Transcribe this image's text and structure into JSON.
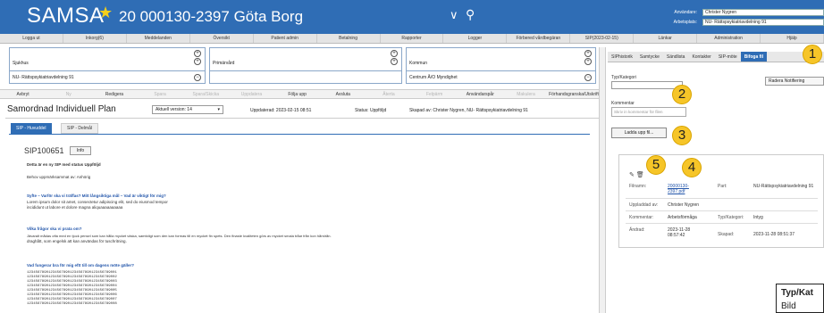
{
  "header": {
    "brand": "SAMSA",
    "patient": "20 000130-2397 Göta Borg",
    "user_label": "Användare:",
    "user_value": "Christer Nygren",
    "unit_label": "Arbetsplats:",
    "unit_value": "NU- Rättspsykiatriavdelning 91"
  },
  "menu": [
    "Logga ut",
    "Inkorg(6)",
    "Meddelanden",
    "Översikt",
    "Patient admin",
    "Betalning",
    "Rapporter",
    "Logger",
    "Förbered vårdbegäran",
    "SIP(2023-02-15)",
    "Länkar",
    "Administration",
    "Hjälp"
  ],
  "care_boxes": [
    {
      "title": "Sjukhus",
      "value": "NU- Rättspsykiatriavdelning 91"
    },
    {
      "title": "Primärvård",
      "value": ""
    },
    {
      "title": "Kommun",
      "value": "Centrum Å/O Myndighet"
    }
  ],
  "actions": [
    {
      "label": "Avbryt",
      "enabled": true
    },
    {
      "label": "Ny",
      "enabled": false
    },
    {
      "label": "Redigera",
      "enabled": true
    },
    {
      "label": "Spara",
      "enabled": false
    },
    {
      "label": "Spara/Skicka",
      "enabled": false
    },
    {
      "label": "Uppdatera",
      "enabled": false
    },
    {
      "label": "Följa upp",
      "enabled": true
    },
    {
      "label": "Avsluta",
      "enabled": true
    },
    {
      "label": "Återta",
      "enabled": false
    },
    {
      "label": "Felpärm",
      "enabled": false
    },
    {
      "label": "Användarspår",
      "enabled": true
    },
    {
      "label": "Makulera",
      "enabled": false
    },
    {
      "label": "Förhandsgranska/Utskrift",
      "enabled": true
    }
  ],
  "plan": {
    "title": "Samordnad Individuell Plan",
    "version": "Aktuell version: 14",
    "updated": "Uppdaterad: 2023-02-15 08:51",
    "status": "Status: Uppföljd",
    "creator": "Skapad av: Christer Nygren, NU- Rättspsykiatriavdelning 91"
  },
  "tabs": {
    "active": "SIP - Huvuddel",
    "inactive": "SIP - Delmål"
  },
  "doc": {
    "sip_id": "SIP100651",
    "info_label": "Info",
    "line1": "Detta är en ny SIP med status Uppföljd",
    "line2": "Behov uppmärksammat av: Anhörig",
    "h1": "Syfte – Varför ska vi träffas? Mitt långsiktiga mål – Vad är viktigt för mig?",
    "p1a": "Lorem ipsum dolor sit amet, consectetur adipiscing elit, sed do eiusmod tempor",
    "p1b": "incididunt ut labore et dolore magna aliquaaaaaaaaaa",
    "h2": "Vilka frågor ska vi prata om?",
    "p2a": "Jävaralt mådas ofta med en tjock pensel som kan hålla mycket väska, samtidigt som den kan formas till en mycket fin spets. Den finaste kvaliteten görs av mycket smala tråar från kon hårstrån.",
    "p2b": "draghått, som engelsk att kan användas för tuschritning.",
    "h3": "Vad fungerar bra för mig eftt till om dagens möte gäller?",
    "rows": [
      "123456789012345678901234567890123456789001",
      "123456789012345678901234567890123456789002",
      "123456789012345678901234567890123456789003",
      "123456789012345678901234567890123456789004",
      "123456789012345678901234567890123456789005",
      "123456789012345678901234567890123456789006",
      "123456789012345678901234567890123456789007",
      "123456789012345678901234567890123456789008"
    ]
  },
  "right_tabs": [
    "SIPhistorik",
    "Samtycke",
    "Sändlista",
    "Kontakter",
    "SIP-möte",
    "Bifoga fil"
  ],
  "attach": {
    "type_label": "Typ/Kategori",
    "delete_button": "Radera Notifiering",
    "comment_label": "Kommentar",
    "comment_placeholder": "Skriv in kommentar för filen",
    "upload_button": "Ladda upp fil...",
    "file": {
      "filename_key": "Filnamn:",
      "filename_value": "20000130-2397.pdf",
      "part_key": "Part:",
      "part_value": "NU-Rättspsykiatriavdelning 91",
      "uploaded_key": "Uppladdad av:",
      "uploaded_value": "Christer Nygren",
      "comment_key": "Kommentar:",
      "comment_value": "Arbetsförmåga",
      "type_key": "Typ/Kategori:",
      "type_value": "Intyg",
      "changed_key": "Ändrad:",
      "changed_value": "2023-11-28 08:57:42",
      "created_key": "Skapad:",
      "created_value": "2023-11-28 08:51:37"
    }
  },
  "badges": [
    "1",
    "2",
    "3",
    "4",
    "5"
  ],
  "tooltip": {
    "header": "Typ/Kat",
    "value": "Bild"
  },
  "colors": {
    "brand_blue": "#2f6db5",
    "badge_yellow": "#f6c528",
    "star": "#f5cf1a"
  }
}
